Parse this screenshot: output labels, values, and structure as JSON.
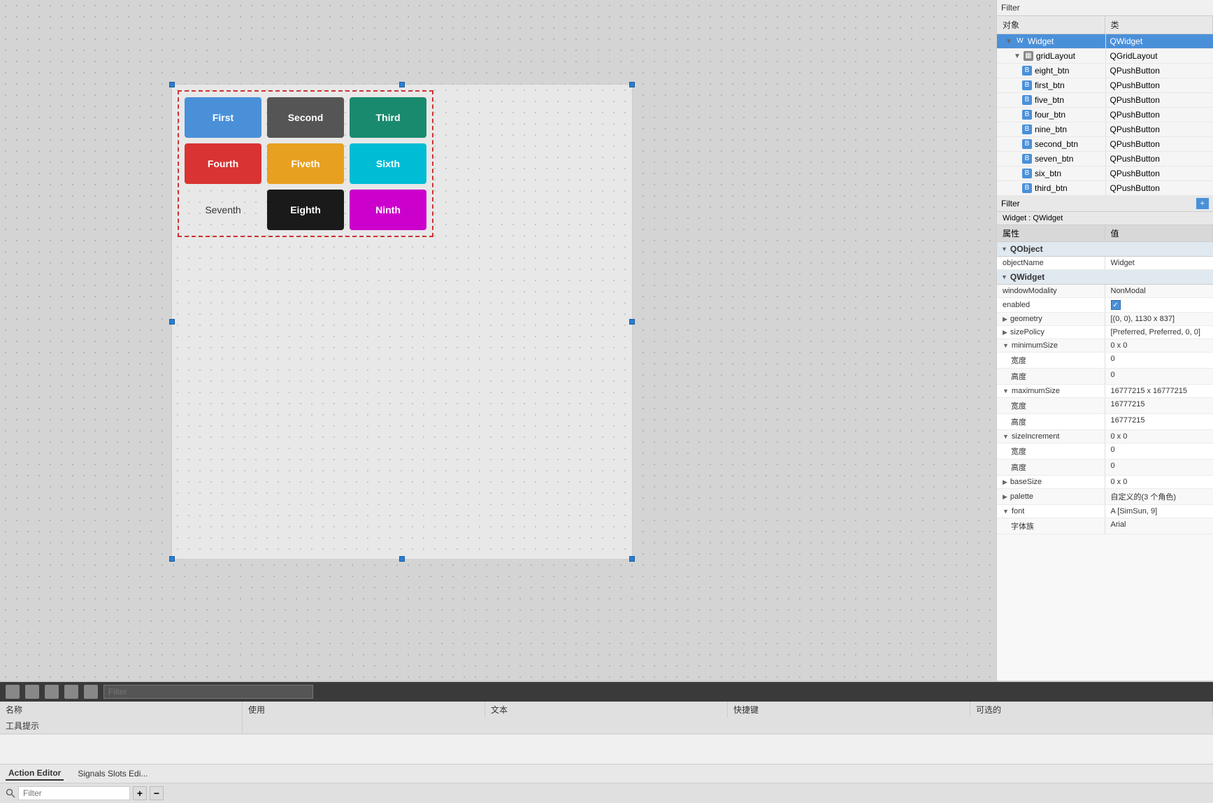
{
  "topFilter": "Filter",
  "rightPanel": {
    "filterLabel": "Filter",
    "treeHeader": {
      "col1": "对象",
      "col2": "类"
    },
    "treeItems": [
      {
        "indent": 1,
        "icon": "widget",
        "expand": true,
        "name": "Widget",
        "type": "QWidget",
        "selected": true
      },
      {
        "indent": 2,
        "icon": "grid",
        "expand": true,
        "name": "gridLayout",
        "type": "QGridLayout",
        "selected": false
      },
      {
        "indent": 3,
        "icon": "btn",
        "expand": false,
        "name": "eight_btn",
        "type": "QPushButton",
        "selected": false
      },
      {
        "indent": 3,
        "icon": "btn",
        "expand": false,
        "name": "first_btn",
        "type": "QPushButton",
        "selected": false
      },
      {
        "indent": 3,
        "icon": "btn",
        "expand": false,
        "name": "five_btn",
        "type": "QPushButton",
        "selected": false
      },
      {
        "indent": 3,
        "icon": "btn",
        "expand": false,
        "name": "four_btn",
        "type": "QPushButton",
        "selected": false
      },
      {
        "indent": 3,
        "icon": "btn",
        "expand": false,
        "name": "nine_btn",
        "type": "QPushButton",
        "selected": false
      },
      {
        "indent": 3,
        "icon": "btn",
        "expand": false,
        "name": "second_btn",
        "type": "QPushButton",
        "selected": false
      },
      {
        "indent": 3,
        "icon": "btn",
        "expand": false,
        "name": "seven_btn",
        "type": "QPushButton",
        "selected": false
      },
      {
        "indent": 3,
        "icon": "btn",
        "expand": false,
        "name": "six_btn",
        "type": "QPushButton",
        "selected": false
      },
      {
        "indent": 3,
        "icon": "btn",
        "expand": false,
        "name": "third_btn",
        "type": "QPushButton",
        "selected": false
      }
    ],
    "propsFilterLabel": "Filter",
    "propsTitle": "Widget : QWidget",
    "propsHeader": {
      "col1": "属性",
      "col2": "值"
    },
    "propsGroups": [
      {
        "groupName": "QObject",
        "rows": [
          {
            "name": "objectName",
            "value": "Widget",
            "type": "text",
            "indent": false
          }
        ]
      },
      {
        "groupName": "QWidget",
        "rows": [
          {
            "name": "windowModality",
            "value": "NonModal",
            "type": "text",
            "indent": false
          },
          {
            "name": "enabled",
            "value": "",
            "type": "checkbox",
            "indent": false
          },
          {
            "name": "geometry",
            "value": "[(0, 0), 1130 x 837]",
            "type": "expand",
            "indent": false
          },
          {
            "name": "sizePolicy",
            "value": "[Preferred, Preferred, 0, 0]",
            "type": "expand",
            "indent": false
          },
          {
            "name": "minimumSize",
            "value": "0 x 0",
            "type": "expand",
            "indent": false
          },
          {
            "name": "宽度",
            "value": "0",
            "type": "text",
            "indent": true
          },
          {
            "name": "高度",
            "value": "0",
            "type": "text",
            "indent": true
          },
          {
            "name": "maximumSize",
            "value": "16777215 x 16777215",
            "type": "expand",
            "indent": false
          },
          {
            "name": "宽度",
            "value": "16777215",
            "type": "text",
            "indent": true
          },
          {
            "name": "高度",
            "value": "16777215",
            "type": "text",
            "indent": true
          },
          {
            "name": "sizeIncrement",
            "value": "0 x 0",
            "type": "expand",
            "indent": false
          },
          {
            "name": "宽度",
            "value": "0",
            "type": "text",
            "indent": true
          },
          {
            "name": "高度",
            "value": "0",
            "type": "text",
            "indent": true
          },
          {
            "name": "baseSize",
            "value": "0 x 0",
            "type": "expand",
            "indent": false
          },
          {
            "name": "palette",
            "value": "自定义的(3 个角色)",
            "type": "expand",
            "indent": false
          },
          {
            "name": "font",
            "value": "A  [SimSun, 9]",
            "type": "expand",
            "indent": false
          },
          {
            "name": "字体族",
            "value": "Arial",
            "type": "text",
            "indent": true
          }
        ]
      }
    ]
  },
  "buttons": {
    "first": "First",
    "second": "Second",
    "third": "Third",
    "fourth": "Fourth",
    "fifth": "Fiveth",
    "sixth": "Sixth",
    "seventh": "Seventh",
    "eighth": "Eighth",
    "ninth": "Ninth"
  },
  "bottomBar": {
    "filterPlaceholder": "Filter",
    "tableHeaders": [
      "名称",
      "使用",
      "文本",
      "快捷键",
      "可选的",
      "工具提示"
    ],
    "tabs": [
      "Action Editor",
      "Signals Slots Edi..."
    ],
    "searchPlaceholder": "Filter",
    "plusLabel": "+",
    "minusLabel": "-"
  }
}
